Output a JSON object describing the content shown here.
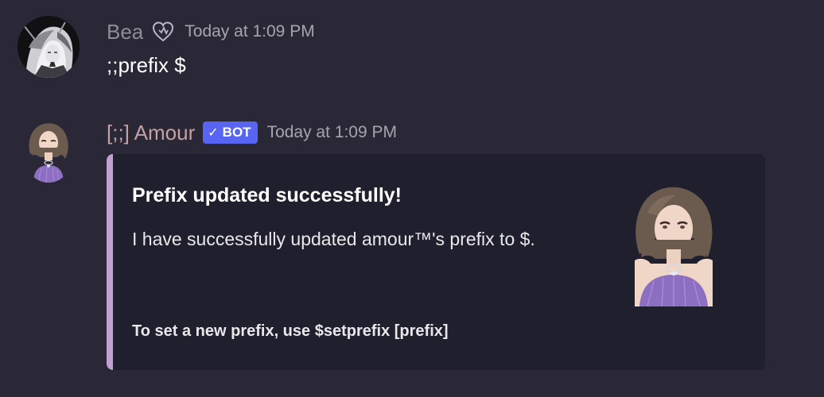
{
  "colors": {
    "background": "#2a2837",
    "embed_background": "#201f2d",
    "embed_accent": "#c39fd4",
    "bot_tag": "#5865f2",
    "bea_name": "#8e8d96",
    "amour_name": "#c4a2a4"
  },
  "messages": [
    {
      "username": "Bea",
      "badge_icon": "heart-outline-icon",
      "timestamp": "Today at 1:09 PM",
      "content": ";;prefix $"
    },
    {
      "username": "[;;] Amour",
      "bot_tag": {
        "check": "✓",
        "label": "BOT"
      },
      "timestamp": "Today at 1:09 PM",
      "embed": {
        "title": "Prefix updated successfully!",
        "description": "I have successfully updated amour™'s prefix to $.",
        "footer": "To set a new prefix, use $setprefix [prefix]"
      }
    }
  ]
}
